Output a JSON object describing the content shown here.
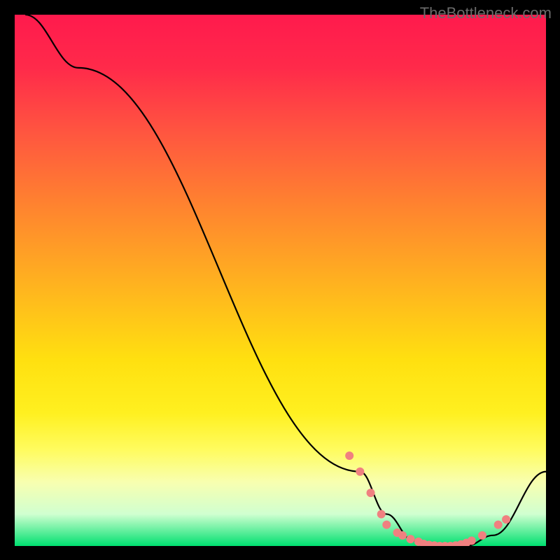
{
  "attribution": "TheBottleneck.com",
  "chart_data": {
    "type": "line",
    "title": "",
    "xlabel": "",
    "ylabel": "",
    "xlim": [
      0,
      100
    ],
    "ylim": [
      0,
      100
    ],
    "series": [
      {
        "name": "bottleneck-curve",
        "x": [
          2,
          12,
          65,
          70,
          75,
          80,
          85,
          90,
          100
        ],
        "y": [
          100,
          90,
          14,
          6,
          1,
          0,
          0,
          2,
          14
        ],
        "color": "#000000"
      }
    ],
    "markers": {
      "name": "optimal-dots",
      "points": [
        {
          "x": 63,
          "y": 17
        },
        {
          "x": 65,
          "y": 14
        },
        {
          "x": 67,
          "y": 10
        },
        {
          "x": 69,
          "y": 6
        },
        {
          "x": 70,
          "y": 4
        },
        {
          "x": 72,
          "y": 2.5
        },
        {
          "x": 73,
          "y": 2
        },
        {
          "x": 74.5,
          "y": 1.3
        },
        {
          "x": 76,
          "y": 0.8
        },
        {
          "x": 77,
          "y": 0.4
        },
        {
          "x": 78,
          "y": 0.2
        },
        {
          "x": 79,
          "y": 0.1
        },
        {
          "x": 80,
          "y": 0
        },
        {
          "x": 81,
          "y": 0
        },
        {
          "x": 82,
          "y": 0
        },
        {
          "x": 83,
          "y": 0.1
        },
        {
          "x": 84,
          "y": 0.3
        },
        {
          "x": 85,
          "y": 0.6
        },
        {
          "x": 86,
          "y": 1
        },
        {
          "x": 88,
          "y": 2
        },
        {
          "x": 91,
          "y": 4
        },
        {
          "x": 92.5,
          "y": 5
        }
      ],
      "color": "#f08080",
      "radius": 6
    },
    "background": {
      "type": "vertical-gradient",
      "stops": [
        {
          "pos": 0,
          "color": "#ff1a4d"
        },
        {
          "pos": 0.5,
          "color": "#ffe010"
        },
        {
          "pos": 1.0,
          "color": "#00e070"
        }
      ]
    }
  }
}
